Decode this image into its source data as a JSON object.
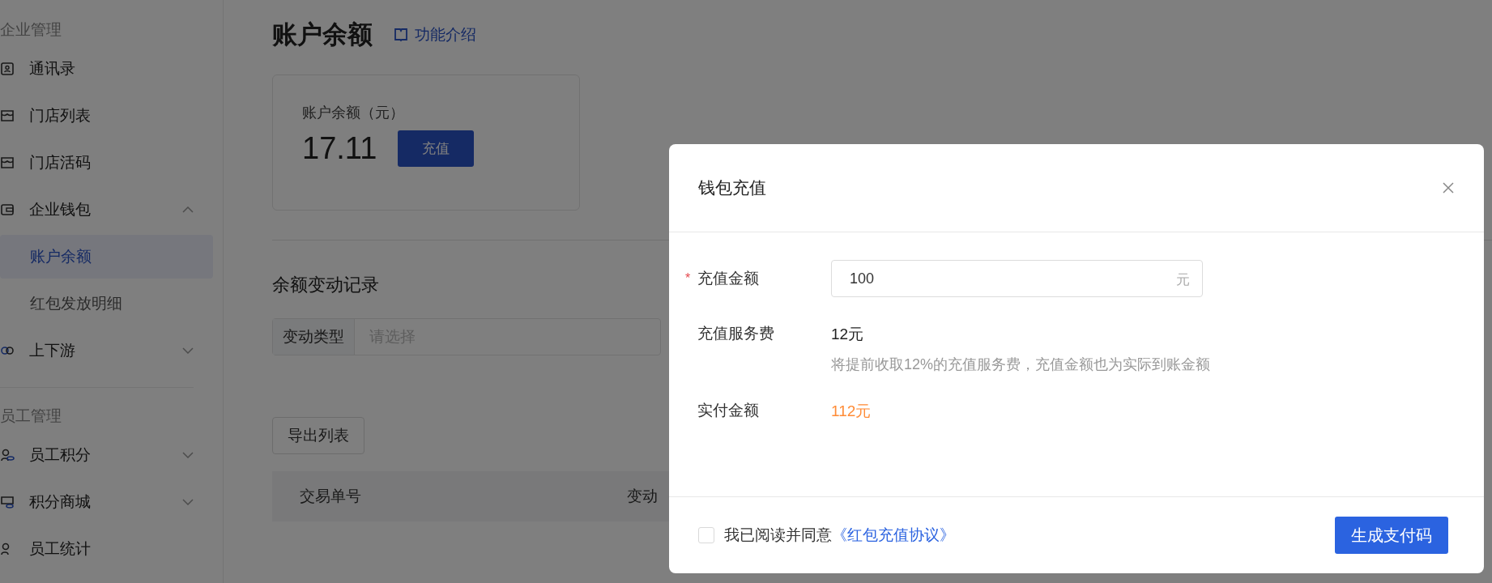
{
  "sidebar": {
    "sections": [
      {
        "title": "企业管理",
        "items": [
          {
            "label": "通讯录",
            "selected": false
          },
          {
            "label": "门店列表",
            "selected": false
          },
          {
            "label": "门店活码",
            "selected": false
          },
          {
            "label": "企业钱包",
            "selected": false,
            "expanded": true,
            "children": [
              {
                "label": "账户余额",
                "selected": true
              },
              {
                "label": "红包发放明细",
                "selected": false
              }
            ]
          },
          {
            "label": "上下游",
            "selected": false,
            "expanded": false
          }
        ]
      },
      {
        "title": "员工管理",
        "items": [
          {
            "label": "员工积分",
            "selected": false,
            "expanded": false
          },
          {
            "label": "积分商城",
            "selected": false,
            "expanded": false
          },
          {
            "label": "员工统计",
            "selected": false
          }
        ]
      }
    ]
  },
  "page": {
    "title": "账户余额",
    "intro_link": "功能介绍",
    "balance_card": {
      "label": "账户余额（元）",
      "amount": "17.11",
      "button": "充值"
    },
    "records": {
      "title": "余额变动记录",
      "filter": {
        "label": "变动类型",
        "placeholder": "请选择"
      },
      "export_button": "导出列表",
      "table": {
        "columns": [
          "交易单号",
          "变动"
        ]
      }
    }
  },
  "dialog": {
    "title": "钱包充值",
    "rows": [
      {
        "kind": "input",
        "label": "充值金额",
        "required_mark": "*",
        "value": "100",
        "suffix": "元"
      },
      {
        "kind": "text",
        "label": "充值服务费",
        "value": "12元",
        "hint": "将提前收取12%的充值服务费，充值金额也为实际到账金额"
      },
      {
        "kind": "highlight",
        "label": "实付金额",
        "value": "112元"
      }
    ],
    "agreement": {
      "checked": false,
      "text": "我已阅读并同意",
      "link": "《红包充值协议》"
    },
    "confirm_button": "生成支付码"
  }
}
